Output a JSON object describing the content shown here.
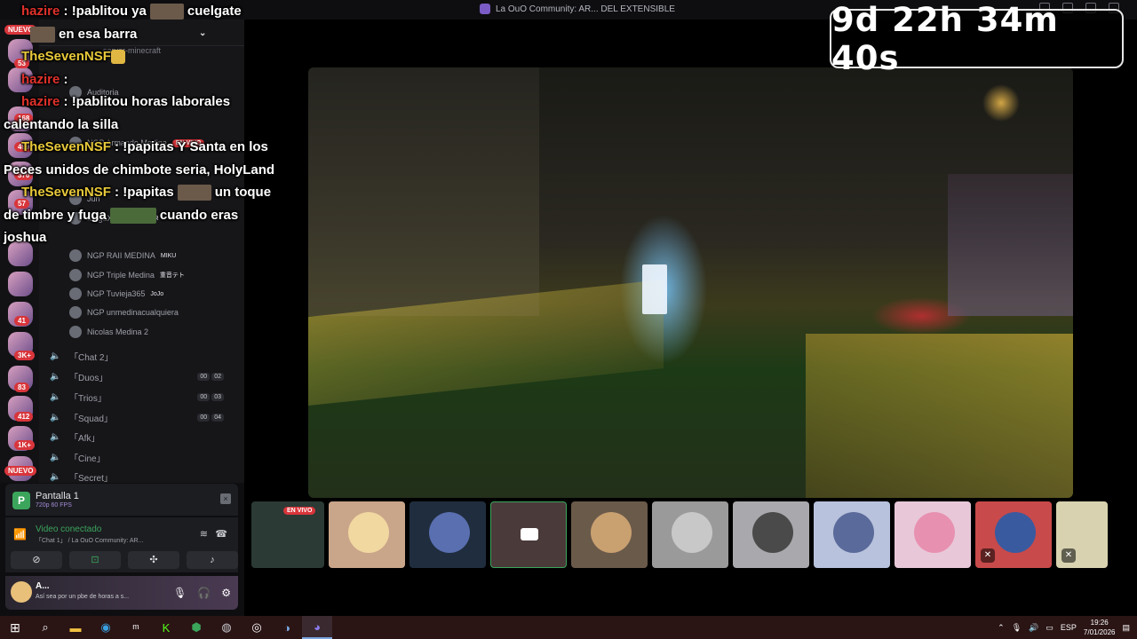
{
  "window": {
    "title": "La OuO Community: AR... DEL EXTENSIBLE"
  },
  "timer": {
    "value": "9d 22h 34m 40s"
  },
  "chat": {
    "messages": [
      {
        "user": "hazire",
        "user_color": "#e0312b",
        "text_before": " : !pablitou ya",
        "text_after": "cuelgate"
      },
      {
        "user": "",
        "user_color": "#ffffff",
        "text_before": "",
        "text_after": "en esa barra"
      },
      {
        "user": "TheSevenNSF",
        "user_color": "#e8c93a",
        "text_before": "",
        "text_after": ""
      },
      {
        "user": "hazire",
        "user_color": "#e0312b",
        "text_before": " :",
        "text_after": ""
      },
      {
        "user": "hazire",
        "user_color": "#e0312b",
        "text_before": " : !pablitou horas laborales",
        "text_after": ""
      },
      {
        "user": "",
        "user_color": "#ffffff",
        "text_before": "calentando la silla",
        "text_after": ""
      },
      {
        "user": "TheSevenNSF",
        "user_color": "#e8c93a",
        "text_before": " : !papitas Y Santa en los",
        "text_after": ""
      },
      {
        "user": "",
        "user_color": "#ffffff",
        "text_before": "Peces unidos de chimbote seria, HolyLand",
        "text_after": ""
      },
      {
        "user": "TheSevenNSF",
        "user_color": "#e8c93a",
        "text_before": " : !papitas",
        "text_after": "un toque"
      },
      {
        "user": "",
        "user_color": "#ffffff",
        "text_before": "de timbre y fuga",
        "text_after": "cuando eras"
      },
      {
        "user": "",
        "user_color": "#ffffff",
        "text_before": "joshua",
        "text_after": ""
      }
    ]
  },
  "rail": {
    "badges": [
      "NUEVO",
      "53",
      "168",
      "499",
      "370",
      "57",
      "41",
      "3K+",
      "83",
      "412",
      "1K+",
      "NUEVO"
    ]
  },
  "channels": {
    "server_name": "server-minecraft",
    "users": [
      {
        "name": "Auditoria",
        "tag": ""
      },
      {
        "name": "NGP Armando Medina",
        "tag": "EN VIVO"
      },
      {
        "name": "Jun",
        "tag": ""
      },
      {
        "name": "MeguX Medina",
        "tag": "STR"
      },
      {
        "name": "NGP Joshua Medina",
        "tag": ""
      },
      {
        "name": "NGP RAII MEDINA",
        "tag": "MIKU"
      },
      {
        "name": "NGP Triple Medina",
        "tag": "重音テト"
      },
      {
        "name": "NGP Tuvieja365",
        "tag": "JoJo"
      },
      {
        "name": "NGP unmedinacualquiera",
        "tag": ""
      },
      {
        "name": "Nicolas Medina 2",
        "tag": ""
      }
    ],
    "voice_channels": [
      {
        "name": "「Chat 2」",
        "count_a": "",
        "count_b": ""
      },
      {
        "name": "「Duos」",
        "count_a": "00",
        "count_b": "02"
      },
      {
        "name": "「Trios」",
        "count_a": "00",
        "count_b": "03"
      },
      {
        "name": "「Squad」",
        "count_a": "00",
        "count_b": "04"
      },
      {
        "name": "「Afk」",
        "count_a": "",
        "count_b": ""
      },
      {
        "name": "「Cine」",
        "count_a": "",
        "count_b": ""
      },
      {
        "name": "「Secret」",
        "count_a": "",
        "count_b": ""
      }
    ]
  },
  "stream_card": {
    "name": "Pantalla 1",
    "quality": "720p 60 FPS"
  },
  "voice": {
    "status": "Video conectado",
    "channel": "「Chat 1」 / La OuO Community: AR..."
  },
  "user": {
    "name": "A...",
    "status": "Así sea por un pbe de horas a s..."
  },
  "strip": {
    "live_label": "EN VIVO"
  },
  "taskbar": {
    "lang": "ESP",
    "time": "19:26",
    "date": "7/01/2026"
  }
}
